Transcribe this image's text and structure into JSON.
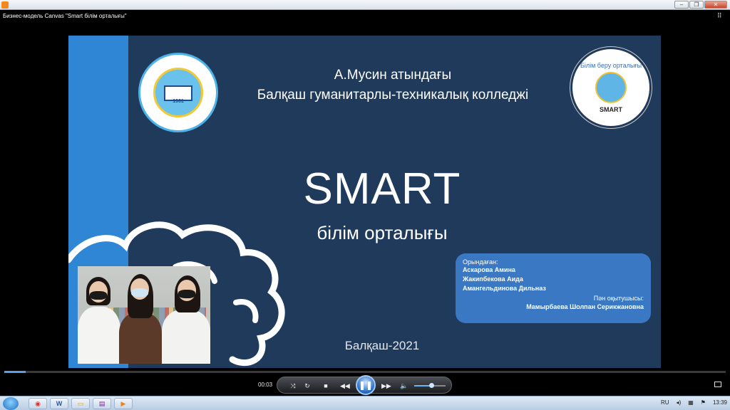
{
  "window": {
    "title": "",
    "video_title": "Бизнес-модель Canvas \"Smart білім орталығы\""
  },
  "slide": {
    "college_line1": "А.Мусин атындағы",
    "college_line2": "Балқаш гуманитарлы-техникалық колледжі",
    "main_title": "SMART",
    "subtitle": "білім орталығы",
    "city_year": "Балқаш-2021",
    "logo_left_year": "1961",
    "logo_right_top": "Білім беру орталығы",
    "logo_right_bottom": "SMART",
    "info": {
      "performed_label": "Орындаған:",
      "students": [
        "Аскарова Амина",
        "Жакипбекова Аида",
        "Амангельдинова Дильназ"
      ],
      "teacher_label": "Пән оқытушысы:",
      "teacher": "Мамырбаева Шолпан Серикжановна"
    },
    "colors": {
      "background": "#1f3a5a",
      "stripe": "#2e86d4",
      "info_box": "#3a78c4"
    }
  },
  "player": {
    "time": "00:03",
    "progress_fraction": 0.03,
    "volume_fraction": 0.55,
    "buttons": [
      "shuffle-icon",
      "repeat-icon",
      "stop-icon",
      "rewind-icon",
      "pause-icon",
      "fast-forward-icon",
      "volume-icon",
      "fullscreen-icon"
    ]
  },
  "taskbar": {
    "items": [
      "chrome-icon",
      "word-icon",
      "explorer-icon",
      "winrar-icon",
      "media-player-icon"
    ],
    "lang": "RU",
    "clock": "13:39"
  }
}
